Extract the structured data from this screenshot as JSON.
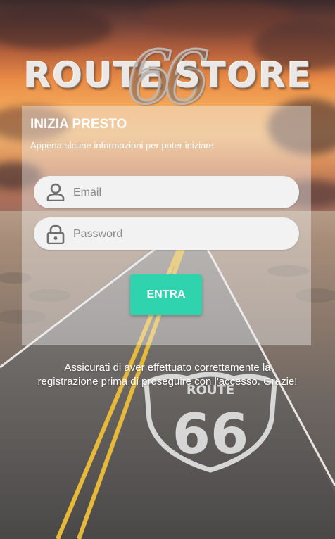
{
  "logo": {
    "left_text": "ROUTE",
    "number": "66",
    "right_text": "STORE"
  },
  "card": {
    "title": "INIZIA PRESTO",
    "subtitle": "Appena alcune informazioni per poter iniziare"
  },
  "form": {
    "email_placeholder": "Email",
    "email_value": "",
    "password_placeholder": "Password",
    "password_value": "",
    "submit_label": "ENTRA"
  },
  "footer": {
    "line1": "Assicurati di aver effettuato correttamente la",
    "line2": "registrazione prima di proseguire con l'accesso. Grazie!"
  },
  "shield": {
    "top_text": "ROUTE",
    "number": "66"
  },
  "icons": {
    "email": "person-icon",
    "password": "lock-icon"
  },
  "colors": {
    "accent": "#2fd3ad",
    "field_bg": "#f2f2f2",
    "text_on_bg": "#ffffff"
  }
}
